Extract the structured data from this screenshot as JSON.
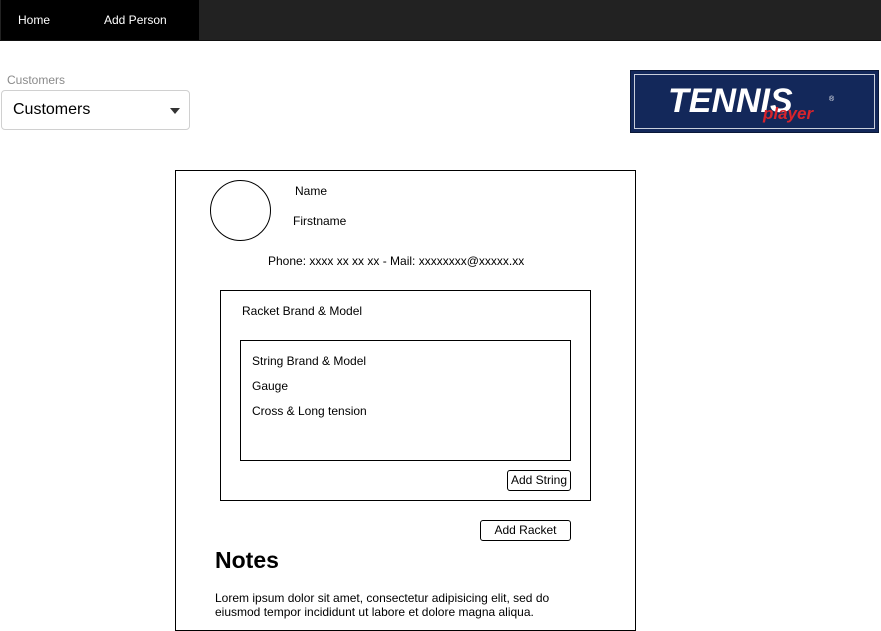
{
  "nav": {
    "home_label": "Home",
    "add_person_label": "Add Person"
  },
  "customer_select": {
    "label": "Customers",
    "selected": "Customers"
  },
  "logo": {
    "main_text": "TENNIS",
    "sub_text": "player",
    "registered_mark": "®",
    "colors": {
      "background": "#13285a",
      "main_text": "#ffffff",
      "sub_text": "#d8242c"
    }
  },
  "customer_card": {
    "name_label": "Name",
    "firstname_label": "Firstname",
    "contact_line": "Phone: xxxx xx xx xx - Mail: xxxxxxxx@xxxxx.xx",
    "racket": {
      "title": "Racket Brand & Model",
      "string": {
        "brand_model": "String Brand & Model",
        "gauge": "Gauge",
        "tension": "Cross & Long tension"
      },
      "add_string_label": "Add String"
    },
    "add_racket_label": "Add Racket",
    "notes": {
      "title": "Notes",
      "body": "Lorem ipsum dolor sit amet, consectetur adipisicing elit, sed do eiusmod tempor incididunt ut labore et dolore magna aliqua."
    }
  }
}
